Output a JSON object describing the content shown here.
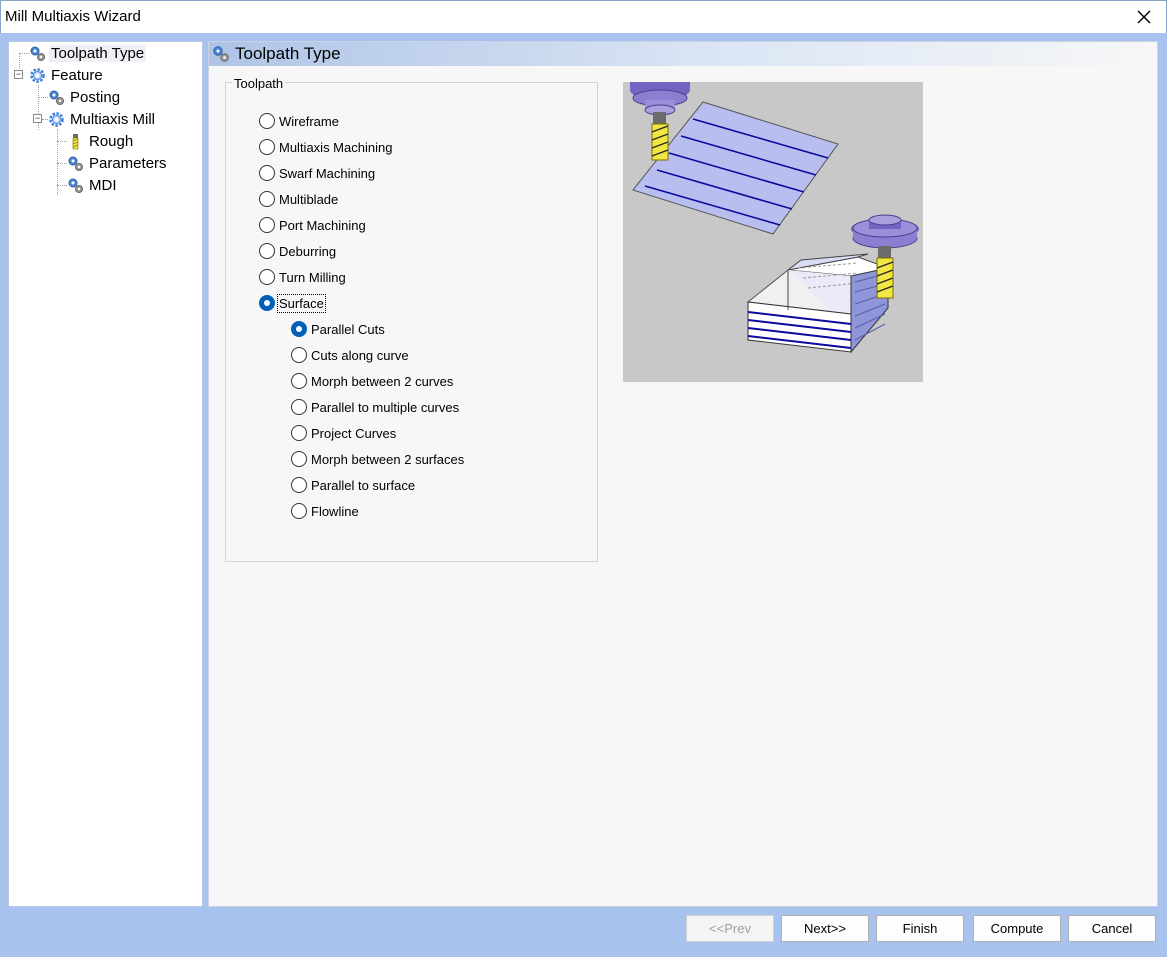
{
  "window": {
    "title": "Mill Multiaxis Wizard"
  },
  "tree": {
    "items": [
      {
        "label": "Toolpath Type"
      },
      {
        "label": "Feature"
      },
      {
        "label": "Posting"
      },
      {
        "label": "Multiaxis Mill"
      },
      {
        "label": "Rough"
      },
      {
        "label": "Parameters"
      },
      {
        "label": "MDI"
      }
    ]
  },
  "page": {
    "title": "Toolpath Type"
  },
  "toolpath": {
    "legend": "Toolpath",
    "options": [
      {
        "label": "Wireframe"
      },
      {
        "label": "Multiaxis Machining"
      },
      {
        "label": "Swarf Machining"
      },
      {
        "label": "Multiblade"
      },
      {
        "label": "Port Machining"
      },
      {
        "label": "Deburring"
      },
      {
        "label": "Turn Milling"
      },
      {
        "label": "Surface",
        "selected": true
      }
    ],
    "surface_options": [
      {
        "label": "Parallel Cuts",
        "selected": true
      },
      {
        "label": "Cuts along curve"
      },
      {
        "label": "Morph between 2 curves"
      },
      {
        "label": "Parallel to multiple curves"
      },
      {
        "label": "Project Curves"
      },
      {
        "label": "Morph between 2 surfaces"
      },
      {
        "label": "Parallel to surface"
      },
      {
        "label": "Flowline"
      }
    ]
  },
  "buttons": {
    "prev": "<<Prev",
    "next": "Next>>",
    "finish": "Finish",
    "compute": "Compute",
    "cancel": "Cancel"
  },
  "colors": {
    "accent": "#005fb8",
    "frame": "#a7c2ec",
    "preview_bg": "#c8c8c8",
    "surface_fill": "#b8bff0",
    "toolpath_line": "#0b0b9c",
    "tool_shank": "#8a7fd0",
    "tool_flute": "#f2e640"
  },
  "icons": {
    "close": "close-icon",
    "gear": "gear-icon",
    "gear_pair": "gear-pair-icon",
    "tool": "mill-tool-icon"
  }
}
